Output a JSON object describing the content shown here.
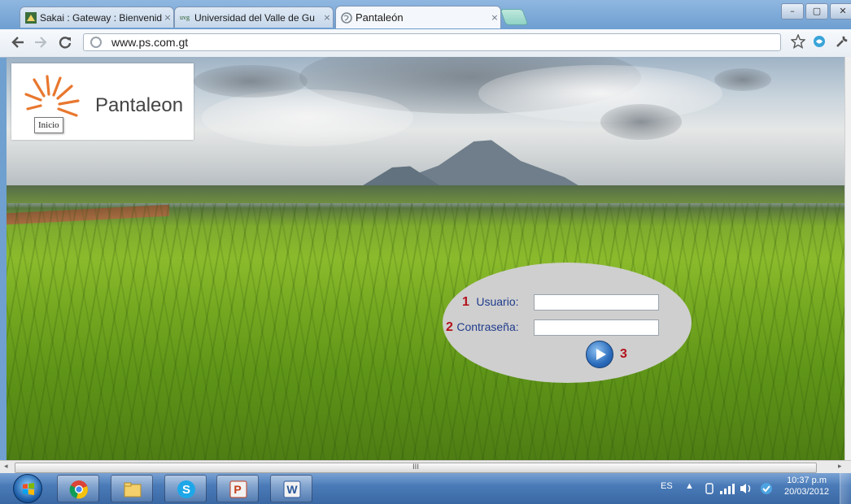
{
  "browser": {
    "tabs": [
      {
        "title": "Sakai : Gateway : Bienvenid",
        "close": "×"
      },
      {
        "title": "Universidad del Valle de Gu",
        "close": "×",
        "favicon_text": "uvg"
      },
      {
        "title": "Pantaleón",
        "close": "×"
      }
    ],
    "url": "www.ps.com.gt",
    "window_controls": {
      "minimize": "–",
      "maximize": "▢",
      "close": "✕"
    },
    "nav_icons": [
      "back-arrow-icon",
      "forward-arrow-icon",
      "reload-icon",
      "globe-icon",
      "star-icon",
      "extension-icon",
      "wrench-icon"
    ]
  },
  "page": {
    "logo": {
      "text": "Pantaleon",
      "tooltip": "Inicio",
      "accent_color": "#e8772e"
    },
    "login": {
      "user": {
        "number": "1",
        "label": "Usuario:",
        "value": ""
      },
      "password": {
        "number": "2",
        "label": "Contraseña:",
        "value": ""
      },
      "submit": {
        "number": "3",
        "icon": "play-arrow-icon"
      },
      "number_color": "#b3121b",
      "label_color": "#1f3b8c"
    },
    "hscroll_grip": "III"
  },
  "taskbar": {
    "apps": [
      "chrome-icon",
      "file-explorer-icon",
      "skype-icon",
      "powerpoint-icon",
      "word-icon"
    ],
    "language": "ES",
    "time": "10:37 p.m",
    "date": "20/03/2012"
  }
}
